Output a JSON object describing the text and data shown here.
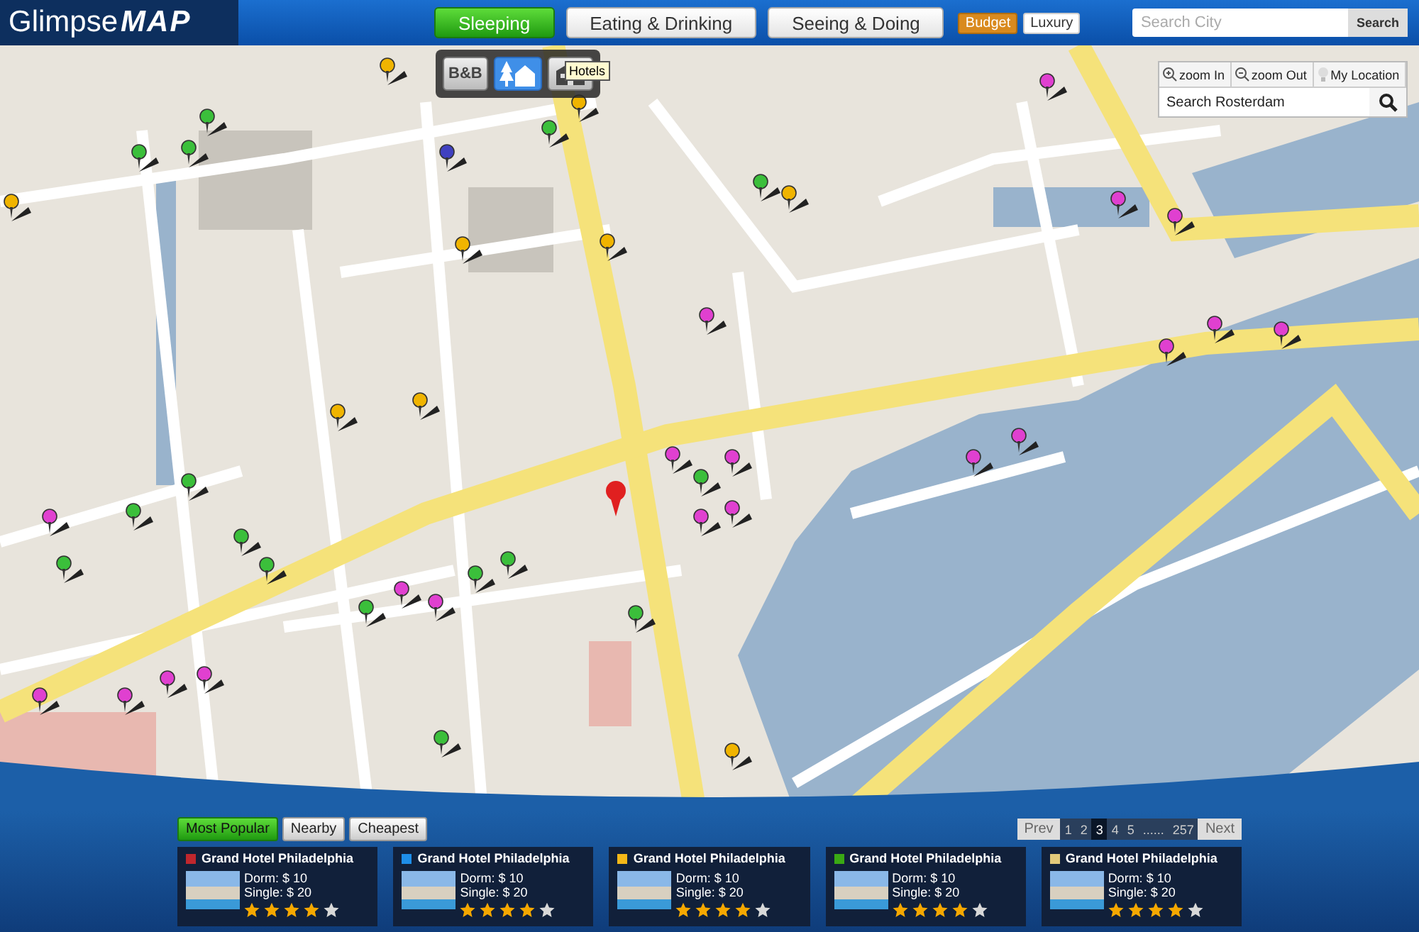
{
  "logo": {
    "text": "Glimpse",
    "mark": "MAP"
  },
  "tabs": [
    {
      "label": "Sleeping",
      "selected": true
    },
    {
      "label": "Eating & Drinking",
      "selected": false
    },
    {
      "label": "Seeing & Doing",
      "selected": false
    }
  ],
  "price_filters": [
    {
      "label": "Budget",
      "selected": true
    },
    {
      "label": "Luxury",
      "selected": false
    }
  ],
  "city_search": {
    "placeholder": "Search City",
    "button": "Search"
  },
  "lodging_types": [
    {
      "kind": "text",
      "label": "B&B",
      "selected": false
    },
    {
      "kind": "hostel",
      "selected": true
    },
    {
      "kind": "hotel",
      "selected": false
    }
  ],
  "tooltip": "Hotels",
  "map_controls": {
    "zoom_in": "zoom In",
    "zoom_out": "zoom Out",
    "my_location": "My Location",
    "search_placeholder": "Search Rosterdam"
  },
  "sort_buttons": [
    {
      "label": "Most Popular",
      "selected": true
    },
    {
      "label": "Nearby",
      "selected": false
    },
    {
      "label": "Cheapest",
      "selected": false
    }
  ],
  "pagination": {
    "prev": "Prev",
    "next": "Next",
    "pages": [
      {
        "label": "1",
        "selected": false
      },
      {
        "label": "2",
        "selected": false
      },
      {
        "label": "3",
        "selected": true
      },
      {
        "label": "4",
        "selected": false
      },
      {
        "label": "5",
        "selected": false
      },
      {
        "label": "......",
        "selected": false
      },
      {
        "label": "257",
        "selected": false
      }
    ]
  },
  "hotels": [
    {
      "name": "Grand Hotel Philadelphia",
      "color": "#c0272d",
      "dorm": "Dorm: $ 10",
      "single": "Single: $ 20",
      "stars": 4
    },
    {
      "name": "Grand Hotel Philadelphia",
      "color": "#1e8ee8",
      "dorm": "Dorm: $ 10",
      "single": "Single: $ 20",
      "stars": 4
    },
    {
      "name": "Grand Hotel Philadelphia",
      "color": "#f5b818",
      "dorm": "Dorm: $ 10",
      "single": "Single: $ 20",
      "stars": 4
    },
    {
      "name": "Grand Hotel Philadelphia",
      "color": "#3aa914",
      "dorm": "Dorm: $ 10",
      "single": "Single: $ 20",
      "stars": 4
    },
    {
      "name": "Grand Hotel Philadelphia",
      "color": "#e2c97a",
      "dorm": "Dorm: $ 10",
      "single": "Single: $ 20",
      "stars": 4
    }
  ]
}
